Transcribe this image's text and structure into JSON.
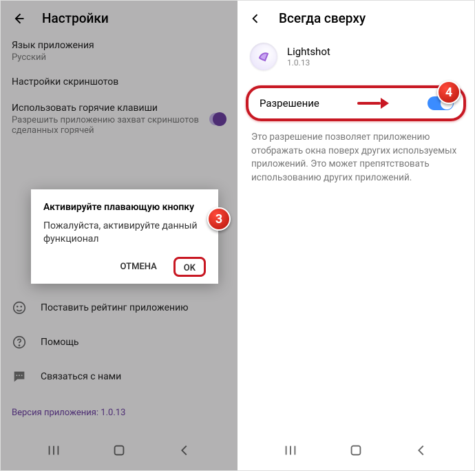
{
  "left": {
    "header_title": "Настройки",
    "lang_title": "Язык приложения",
    "lang_value": "Русский",
    "shot_settings": "Настройки скриншотов",
    "hotkey_title": "Использовать горячие клавиши",
    "hotkey_sub": "Разрешить приложению захват скриншотов сделанных горячей",
    "dialog_title": "Активируйте плавающую кнопку",
    "dialog_body": "Пожалуйста, активируйте данный функционал",
    "cancel": "ОТМЕНА",
    "ok": "OK",
    "rate": "Поставить рейтинг приложению",
    "help": "Помощь",
    "contact": "Связаться с нами",
    "version": "Версия приложения: 1.0.13"
  },
  "right": {
    "header_title": "Всегда сверху",
    "app_name": "Lightshot",
    "app_version": "1.0.13",
    "perm_label": "Разрешение",
    "desc": "Это разрешение позволяет приложению отображать окна поверх других используемых приложений. Это может препятствовать использованию других приложений."
  },
  "badges": {
    "b3": "3",
    "b4": "4"
  }
}
